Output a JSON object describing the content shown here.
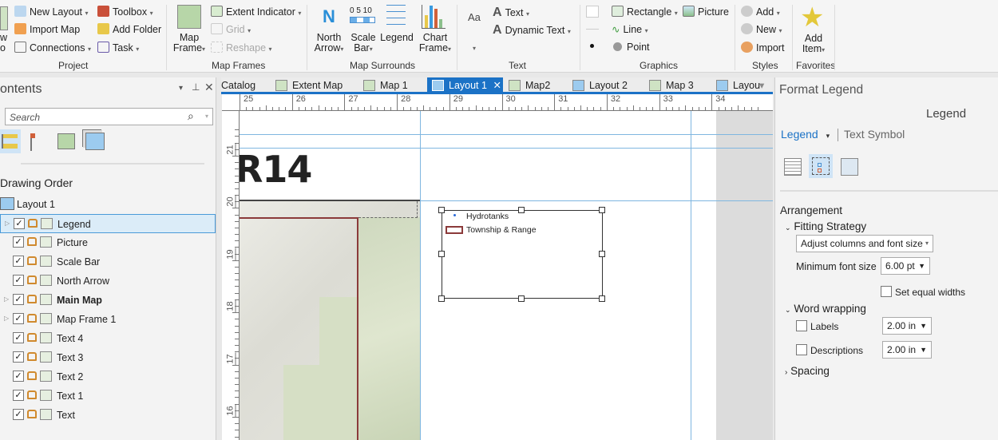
{
  "ribbon": {
    "project": {
      "label": "Project",
      "new_layout": "New Layout",
      "import_map": "Import Map",
      "connections": "Connections",
      "toolbox": "Toolbox",
      "add_folder": "Add Folder",
      "task": "Task",
      "new_partial": "w",
      "new_partial2": "o"
    },
    "map_frames": {
      "label": "Map Frames",
      "map_frame": "Map",
      "map_frame2": "Frame",
      "extent_indicator": "Extent Indicator",
      "grid": "Grid",
      "reshape": "Reshape"
    },
    "map_surrounds": {
      "label": "Map Surrounds",
      "north_arrow": "North",
      "north_arrow2": "Arrow",
      "scale_bar": "Scale",
      "scale_bar2": "Bar",
      "scale_ticks": "0  5  10",
      "legend": "Legend",
      "chart_frame": "Chart",
      "chart_frame2": "Frame"
    },
    "text": {
      "label": "Text",
      "aa": "Aa",
      "text": "Text",
      "dynamic_text": "Dynamic Text"
    },
    "graphics": {
      "label": "Graphics",
      "rectangle": "Rectangle",
      "picture": "Picture",
      "line": "Line",
      "point": "Point"
    },
    "styles": {
      "label": "Styles",
      "add": "Add",
      "new": "New",
      "import": "Import"
    },
    "favorites": {
      "label": "Favorites",
      "add_item": "Add",
      "add_item2": "Item"
    }
  },
  "contents": {
    "title": "ontents",
    "search_placeholder": "Search",
    "section": "Drawing Order",
    "root": "Layout 1",
    "items": [
      {
        "label": "Legend",
        "checked": true,
        "expandable": true,
        "selected": true,
        "bold": false
      },
      {
        "label": "Picture",
        "checked": true
      },
      {
        "label": "Scale Bar",
        "checked": true
      },
      {
        "label": "North Arrow",
        "checked": true
      },
      {
        "label": "Main Map",
        "checked": true,
        "expandable": true,
        "bold": true
      },
      {
        "label": "Map Frame 1",
        "checked": true,
        "expandable": true
      },
      {
        "label": "Text 4",
        "checked": true
      },
      {
        "label": "Text 3",
        "checked": true
      },
      {
        "label": "Text 2",
        "checked": true
      },
      {
        "label": "Text 1",
        "checked": true
      },
      {
        "label": "Text",
        "checked": true
      }
    ]
  },
  "tabs": [
    {
      "label": "Catalog"
    },
    {
      "label": "Extent Map"
    },
    {
      "label": "Map 1"
    },
    {
      "label": "Layout 1",
      "active": true
    },
    {
      "label": "Map2"
    },
    {
      "label": "Layout 2"
    },
    {
      "label": "Map 3"
    },
    {
      "label": "Layou"
    }
  ],
  "rulers": {
    "top": [
      "25",
      "26",
      "27",
      "28",
      "29",
      "30",
      "31",
      "32",
      "33",
      "34"
    ],
    "left": [
      "21",
      "20",
      "19",
      "18",
      "17",
      "16"
    ]
  },
  "layout": {
    "title_text": "R14",
    "legend_items": [
      "Hydrotanks",
      "Township & Range"
    ]
  },
  "format": {
    "title": "Format Legend",
    "element": "Legend",
    "tab_legend": "Legend",
    "tab_text_symbol": "Text Symbol",
    "arrangement": "Arrangement",
    "fitting_strategy": "Fitting Strategy",
    "fitting_value": "Adjust columns and font size",
    "min_font_label": "Minimum font size",
    "min_font_value": "6.00 pt",
    "equal_widths": "Set equal widths",
    "word_wrapping": "Word wrapping",
    "labels": "Labels",
    "labels_value": "2.00 in",
    "descriptions": "Descriptions",
    "descriptions_value": "2.00 in",
    "spacing": "Spacing"
  },
  "colors": {
    "accent": "#1b72c6",
    "boundary": "#8b3a3a",
    "selection": "#dbecf8"
  }
}
